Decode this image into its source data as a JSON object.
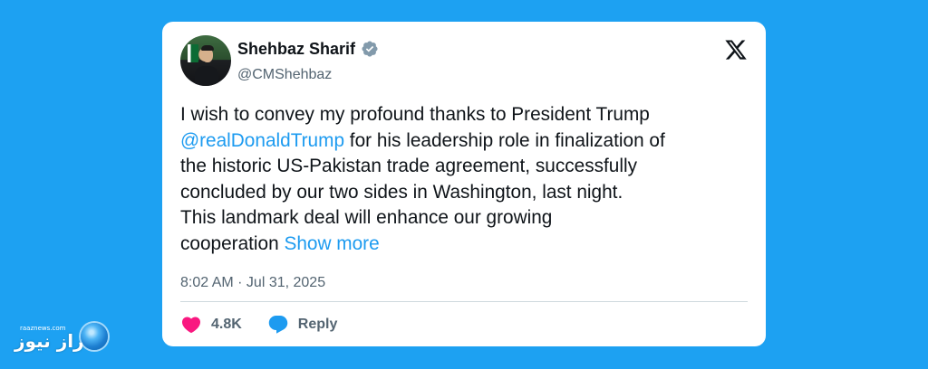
{
  "tweet": {
    "display_name": "Shehbaz Sharif",
    "handle": "@CMShehbaz",
    "text_before_mention": "I wish to convey my profound thanks to President Trump\n",
    "mention": "@realDonaldTrump",
    "text_after_mention": " for his leadership role in finalization of\nthe historic US-Pakistan trade agreement, successfully\nconcluded by our two sides in Washington, last night.\nThis landmark deal will enhance our growing\ncooperation ",
    "show_more": "Show more",
    "timestamp": "8:02 AM · Jul 31, 2025",
    "likes": "4.8K",
    "reply_label": "Reply"
  },
  "watermark": {
    "domain": "raaznews.com",
    "brand": "راز نیوز"
  },
  "icons": {
    "verified": "verified-badge-icon",
    "x_logo": "x-logo-icon",
    "heart": "heart-icon",
    "reply": "reply-bubble-icon",
    "globe": "globe-icon"
  },
  "colors": {
    "background": "#1da1f2",
    "card": "#ffffff",
    "link": "#1d9bf0",
    "text": "#0f1419",
    "muted": "#536471",
    "heart": "#f91880",
    "verified": "#829aab"
  }
}
